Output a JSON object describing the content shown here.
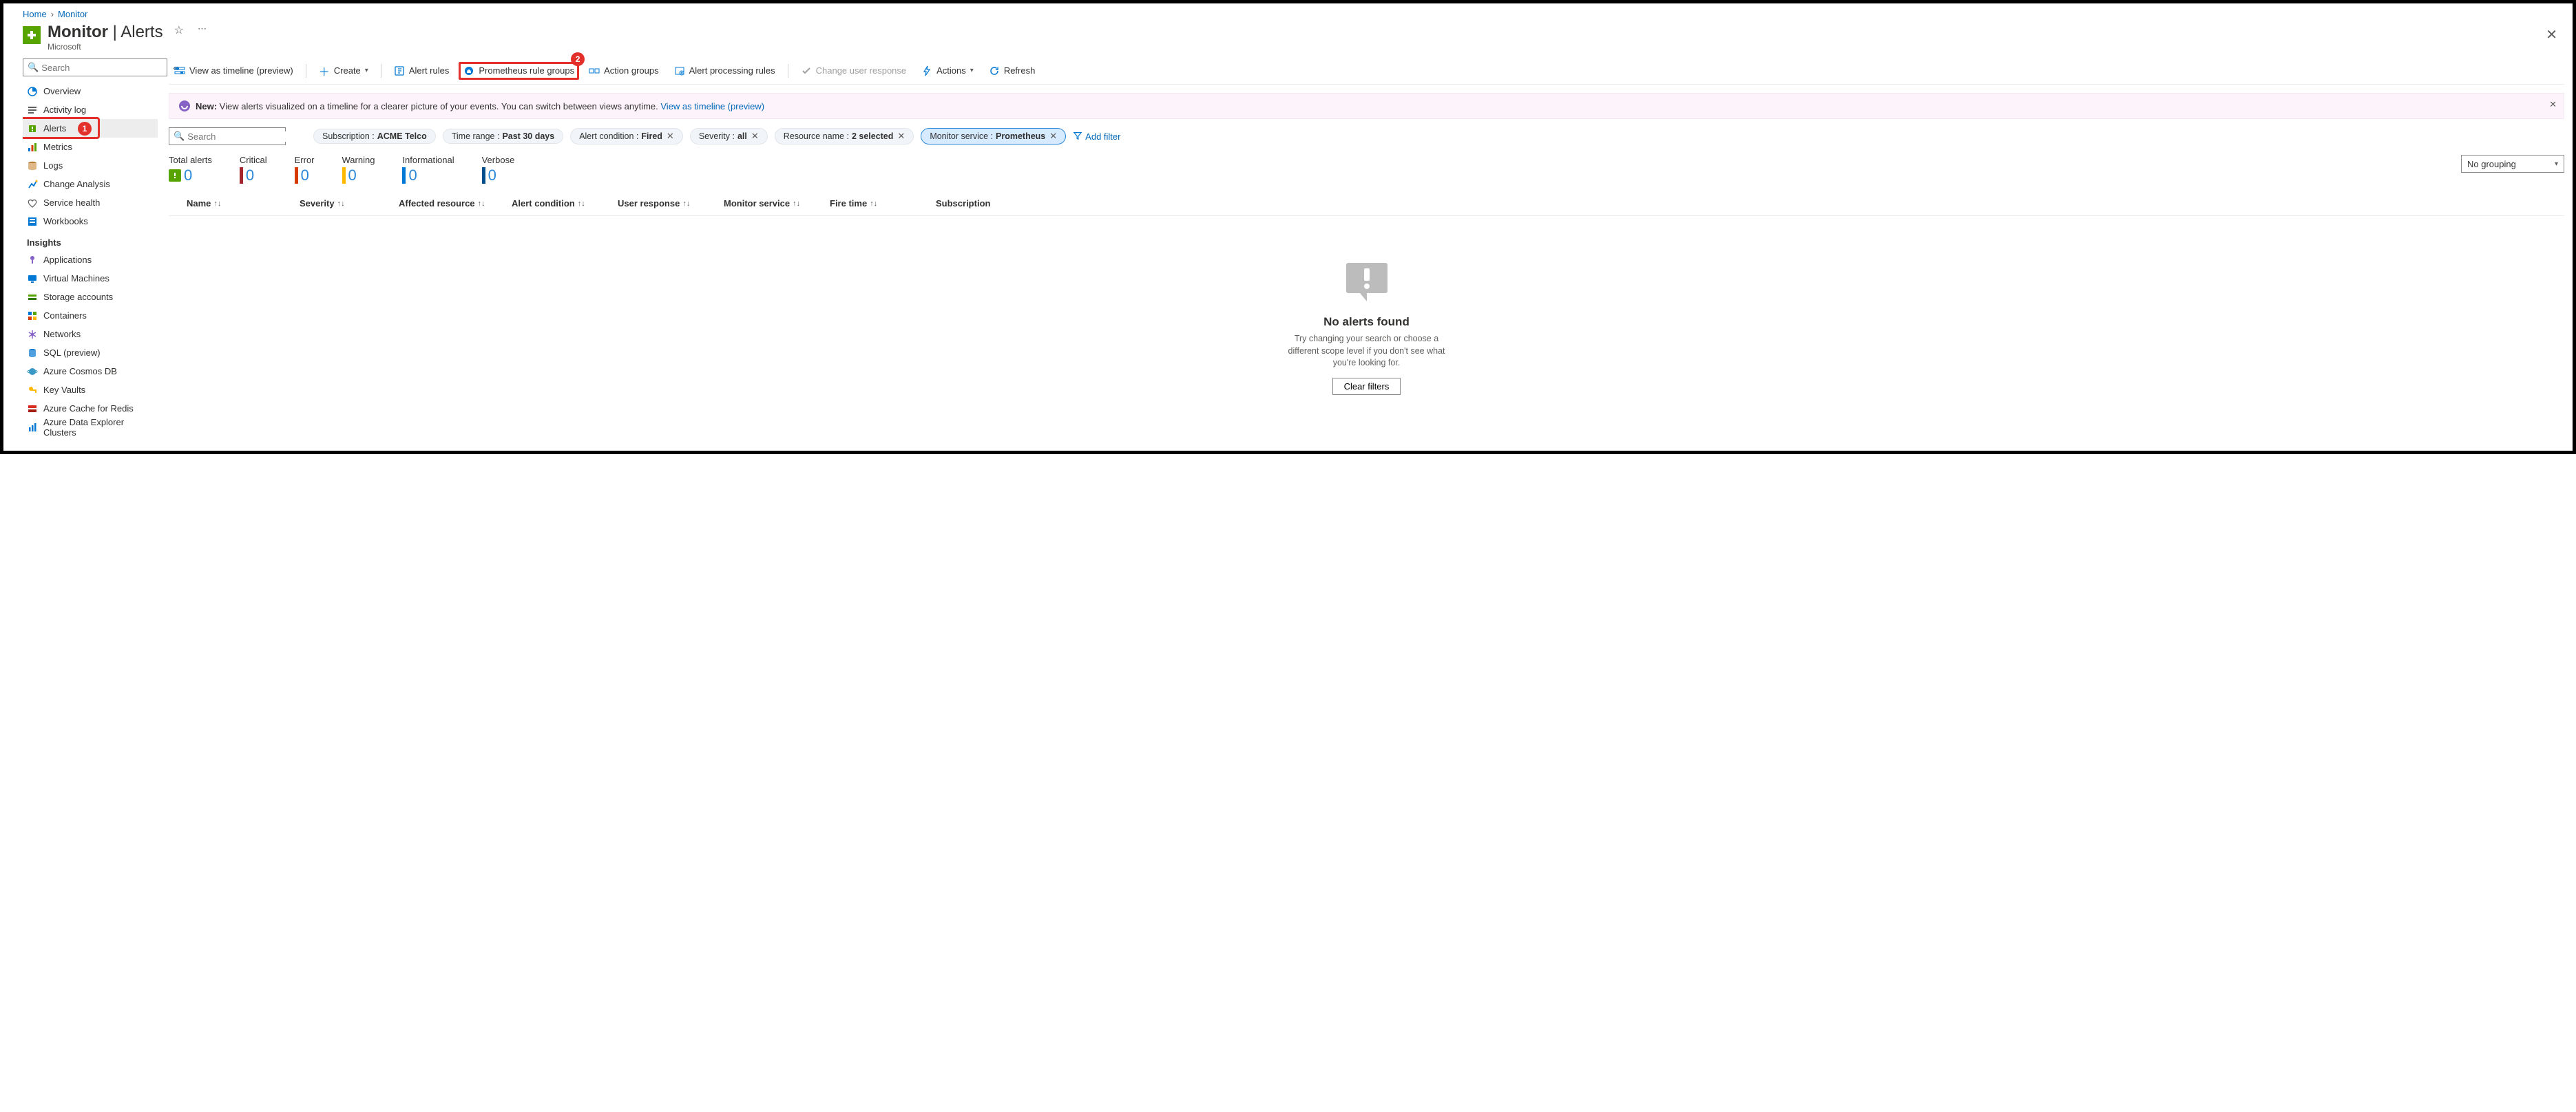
{
  "breadcrumb": {
    "home": "Home",
    "monitor": "Monitor"
  },
  "header": {
    "title_main": "Monitor",
    "title_sep": " | ",
    "title_sub": "Alerts",
    "vendor": "Microsoft"
  },
  "sidebar": {
    "search_placeholder": "Search",
    "items": [
      {
        "label": "Overview",
        "icon": "overview"
      },
      {
        "label": "Activity log",
        "icon": "activity"
      },
      {
        "label": "Alerts",
        "icon": "alerts",
        "selected": true
      },
      {
        "label": "Metrics",
        "icon": "metrics"
      },
      {
        "label": "Logs",
        "icon": "logs"
      },
      {
        "label": "Change Analysis",
        "icon": "change"
      },
      {
        "label": "Service health",
        "icon": "health"
      },
      {
        "label": "Workbooks",
        "icon": "workbooks"
      }
    ],
    "insights_label": "Insights",
    "insights": [
      {
        "label": "Applications",
        "icon": "app"
      },
      {
        "label": "Virtual Machines",
        "icon": "vm"
      },
      {
        "label": "Storage accounts",
        "icon": "storage"
      },
      {
        "label": "Containers",
        "icon": "containers"
      },
      {
        "label": "Networks",
        "icon": "networks"
      },
      {
        "label": "SQL (preview)",
        "icon": "sql"
      },
      {
        "label": "Azure Cosmos DB",
        "icon": "cosmos"
      },
      {
        "label": "Key Vaults",
        "icon": "keyvault"
      },
      {
        "label": "Azure Cache for Redis",
        "icon": "redis"
      },
      {
        "label": "Azure Data Explorer Clusters",
        "icon": "adx"
      }
    ]
  },
  "toolbar": {
    "timeline": "View as timeline (preview)",
    "create": "Create",
    "alert_rules": "Alert rules",
    "prometheus": "Prometheus rule groups",
    "action_groups": "Action groups",
    "processing_rules": "Alert processing rules",
    "change_response": "Change user response",
    "actions": "Actions",
    "refresh": "Refresh"
  },
  "banner": {
    "new_label": "New:",
    "text": " View alerts visualized on a timeline for a clearer picture of your events. You can switch between views anytime. ",
    "link": "View as timeline (preview)"
  },
  "filters": {
    "search_placeholder": "Search",
    "subscription": {
      "k": "Subscription : ",
      "v": "ACME Telco"
    },
    "time_range": {
      "k": "Time range : ",
      "v": "Past 30 days"
    },
    "alert_condition": {
      "k": "Alert condition : ",
      "v": "Fired"
    },
    "severity": {
      "k": "Severity : ",
      "v": "all"
    },
    "resource_name": {
      "k": "Resource name : ",
      "v": "2 selected"
    },
    "monitor_service": {
      "k": "Monitor service : ",
      "v": "Prometheus"
    },
    "add_filter": "Add filter"
  },
  "summary": {
    "total": {
      "lbl": "Total alerts",
      "val": "0"
    },
    "critical": {
      "lbl": "Critical",
      "val": "0",
      "color": "#a4262c"
    },
    "error": {
      "lbl": "Error",
      "val": "0",
      "color": "#d83b01"
    },
    "warning": {
      "lbl": "Warning",
      "val": "0",
      "color": "#ffb900"
    },
    "informational": {
      "lbl": "Informational",
      "val": "0",
      "color": "#0078d4"
    },
    "verbose": {
      "lbl": "Verbose",
      "val": "0",
      "color": "#004e8c"
    },
    "grouping": "No grouping"
  },
  "columns": {
    "name": "Name",
    "severity": "Severity",
    "affected": "Affected resource",
    "condition": "Alert condition",
    "response": "User response",
    "monitor": "Monitor service",
    "fire": "Fire time",
    "subscription": "Subscription"
  },
  "empty": {
    "title": "No alerts found",
    "text": "Try changing your search or choose a different scope level if you don't see what you're looking for.",
    "button": "Clear filters"
  },
  "callouts": {
    "one": "1",
    "two": "2"
  }
}
